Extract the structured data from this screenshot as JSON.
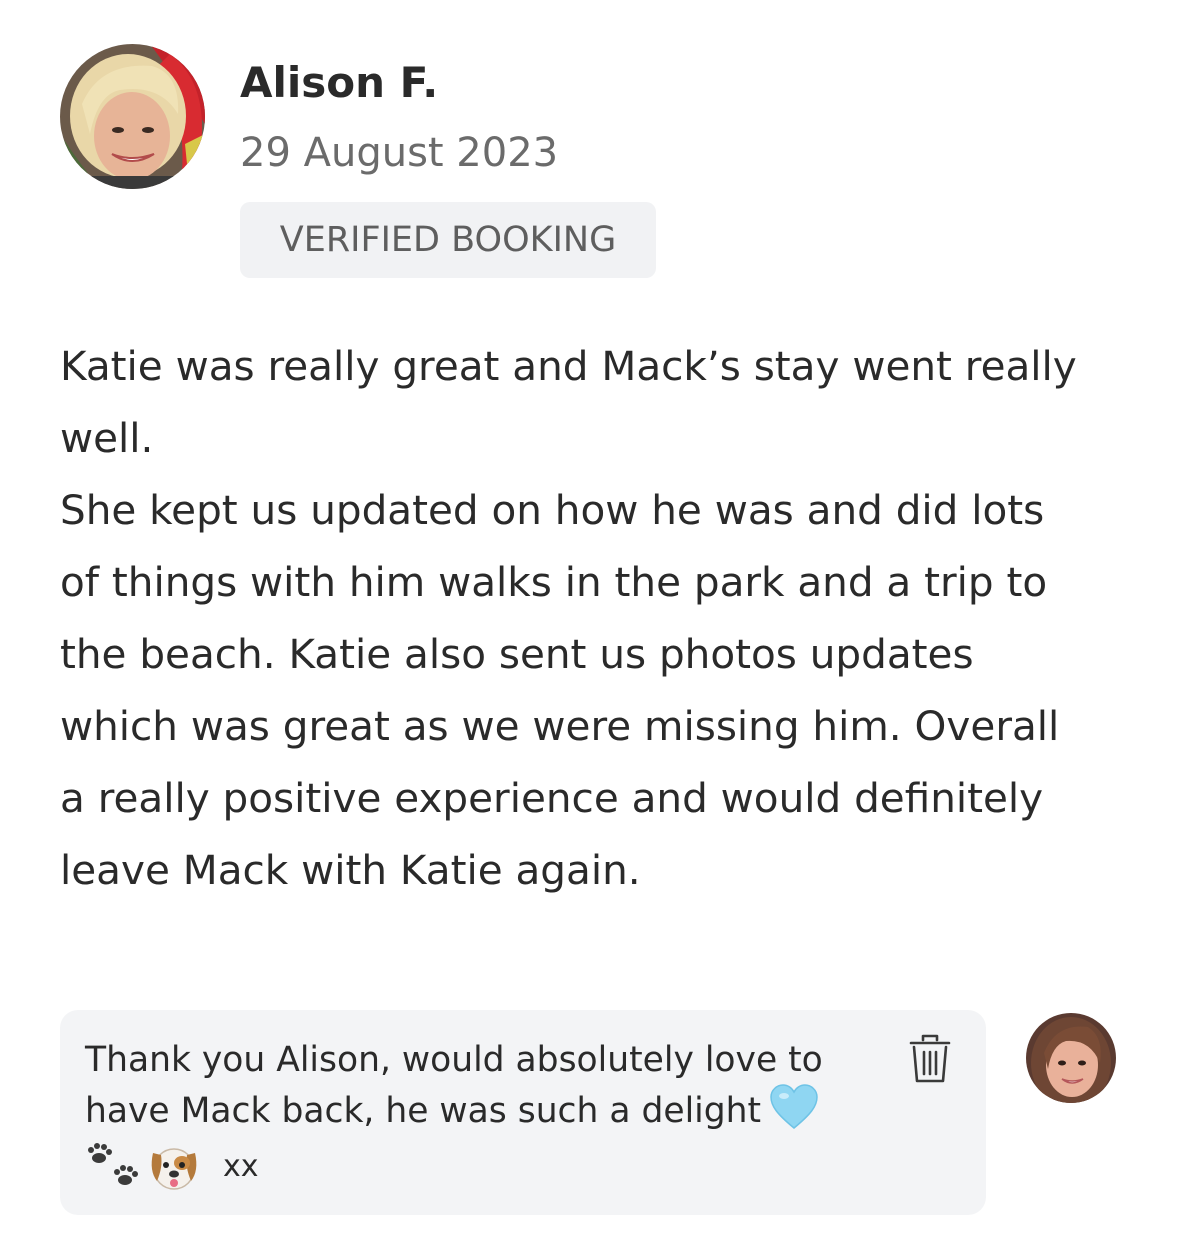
{
  "review": {
    "reviewer_name": "Alison F.",
    "date": "29 August 2023",
    "badge": "VERIFIED BOOKING",
    "avatar_icon": "reviewer-avatar-photo",
    "body_lines": [
      "Katie was really great and Mack’s stay went really",
      "well.",
      "She kept us updated on how he was and did lots",
      "of things with him walks in the park and a trip to",
      "the beach. Katie also sent us photos updates",
      "which was great as we were missing him. Overall",
      "a really positive experience and would definitely",
      "leave Mack with Katie again."
    ]
  },
  "reply": {
    "lines": [
      "Thank you Alison, would absolutely love to",
      "have Mack back, he was such a delight"
    ],
    "heart_emoji": "light-blue-heart-emoji",
    "paw_emoji": "paw-prints-emoji",
    "dog_emoji": "dog-face-emoji",
    "signoff": "xx",
    "delete_icon": "trash-icon",
    "avatar_icon": "sitter-avatar-photo"
  },
  "colors": {
    "badge_bg": "#f1f2f4",
    "reply_bg": "#f3f4f6",
    "heart": "#8fd6f2",
    "muted_text": "#6b6b6b"
  }
}
